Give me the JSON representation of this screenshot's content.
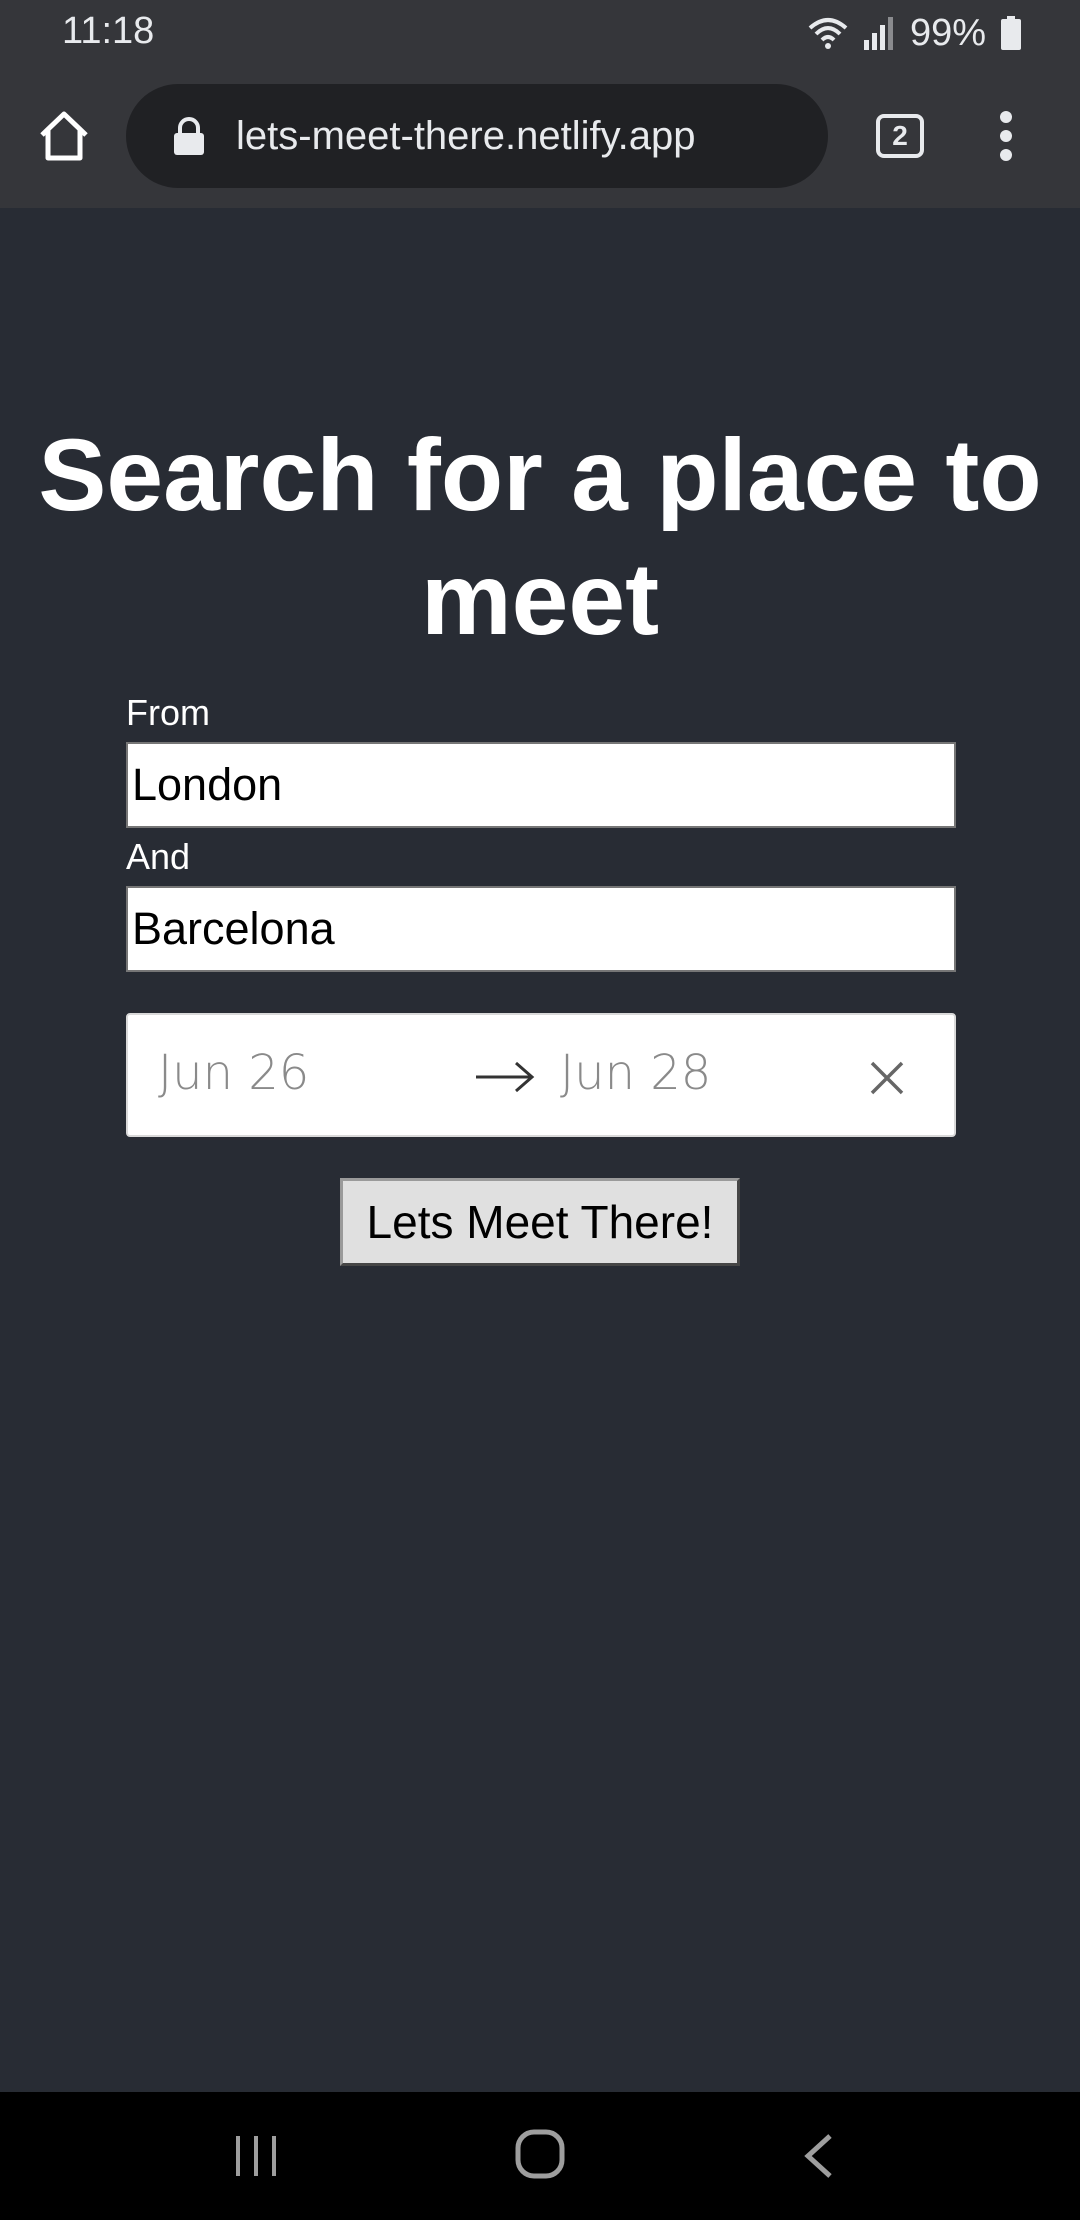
{
  "status_bar": {
    "time": "11:18",
    "battery": "99%",
    "icons": [
      "wifi-icon",
      "signal-icon",
      "battery-icon"
    ]
  },
  "browser": {
    "url": "lets-meet-there.netlify.app",
    "tab_count": "2",
    "icons": [
      "home-icon",
      "lock-icon",
      "tabs-icon",
      "more-vert-icon"
    ]
  },
  "page": {
    "title": "Search for a place to meet",
    "from_label": "From",
    "from_value": "London",
    "and_label": "And",
    "and_value": "Barcelona",
    "date_start": "Jun 26",
    "date_end": "Jun 28",
    "submit_label": "Lets Meet There!"
  },
  "nav_bar": {
    "icons": [
      "recents-icon",
      "home-icon",
      "back-icon"
    ]
  },
  "colors": {
    "page_background": "#282c34",
    "browser_chrome": "#35363a",
    "url_bar": "#202124"
  }
}
